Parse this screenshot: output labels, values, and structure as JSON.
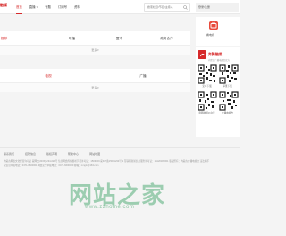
{
  "header": {
    "logo": "融媒",
    "nav": [
      "首页",
      "直播",
      "专题",
      "订阅号",
      "资料"
    ],
    "nav_dropdown_mark": "▾",
    "search_placeholder": "搜索栏目/节目/主持人",
    "login_text": "登录/注册"
  },
  "panels": [
    {
      "tabs": [
        "推荐",
        "听播",
        "盟市",
        "政务合作"
      ],
      "more": "更多 ▾"
    },
    {
      "tabs": [
        "电视",
        "广播"
      ],
      "more": "更多 ▾"
    }
  ],
  "sidebar": {
    "tv_label": "看电视",
    "app_name": "奔腾融媒",
    "app_sub": "内蒙古广播电视台官方",
    "qr_labels": [
      "安卓下载",
      "苹果下载"
    ],
    "qr_labels2": [
      "奔腾融媒公众号",
      "广播电视台"
    ]
  },
  "footer": {
    "links": [
      "联系我们",
      "招聘信息",
      "版权声明",
      "帮助中心",
      "网站地图"
    ],
    "copyright": "内蒙古网络文化经营许可证 蒙网文[2015]1234-028号 信息网络传播视听节目许可证：1503009 蒙ICP备15001234号-1 互联网新闻信息服务许可证：15120180001 版权所有：内蒙古广播电视台 违法和不良信息举报电话：0471-6600001 网络安全举报电话：0471-6600000 邮箱：nmgtv@163.com"
  },
  "watermark": {
    "text": "网站之家",
    "url": "www.zzhome.com"
  },
  "colors": {
    "accent": "#d6292a",
    "page_bg": "#f4f4f4"
  }
}
